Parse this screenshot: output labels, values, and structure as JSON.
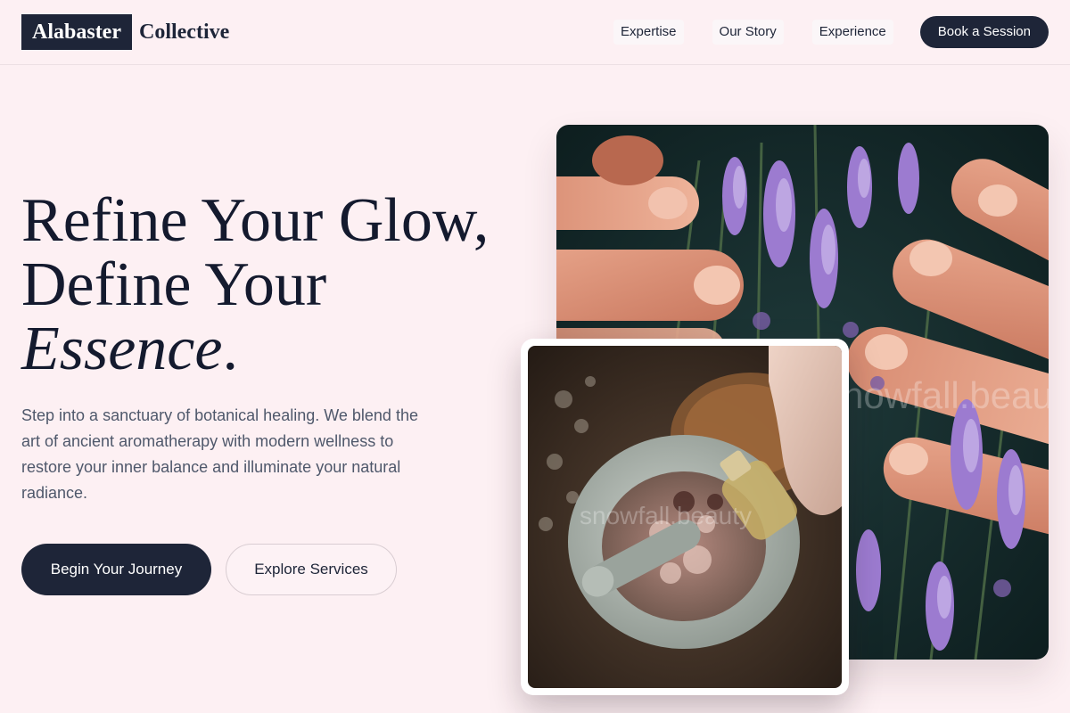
{
  "brand": {
    "name_boxed": "Alabaster",
    "name_rest": "Collective"
  },
  "nav": {
    "links": [
      "Expertise",
      "Our Story",
      "Experience"
    ],
    "cta": "Book a Session"
  },
  "hero": {
    "headline_line1": "Refine Your Glow,",
    "headline_line2": "Define Your",
    "headline_emphasis": "Essence",
    "headline_period": ".",
    "description": "Step into a sanctuary of botanical healing. We blend the art of ancient aromatherapy with modern wellness to restore your inner balance and illuminate your natural radiance.",
    "primary_button": "Begin Your Journey",
    "secondary_button": "Explore Services"
  },
  "images": {
    "large_alt": "Hands gently touching lavender flowers",
    "small_alt": "Mortar and pestle with botanical ingredients and essential oil dropper",
    "watermark": "snowfall.beauty"
  },
  "colors": {
    "background": "#fdf0f3",
    "primary": "#1e2538",
    "text_muted": "#4f586b"
  }
}
